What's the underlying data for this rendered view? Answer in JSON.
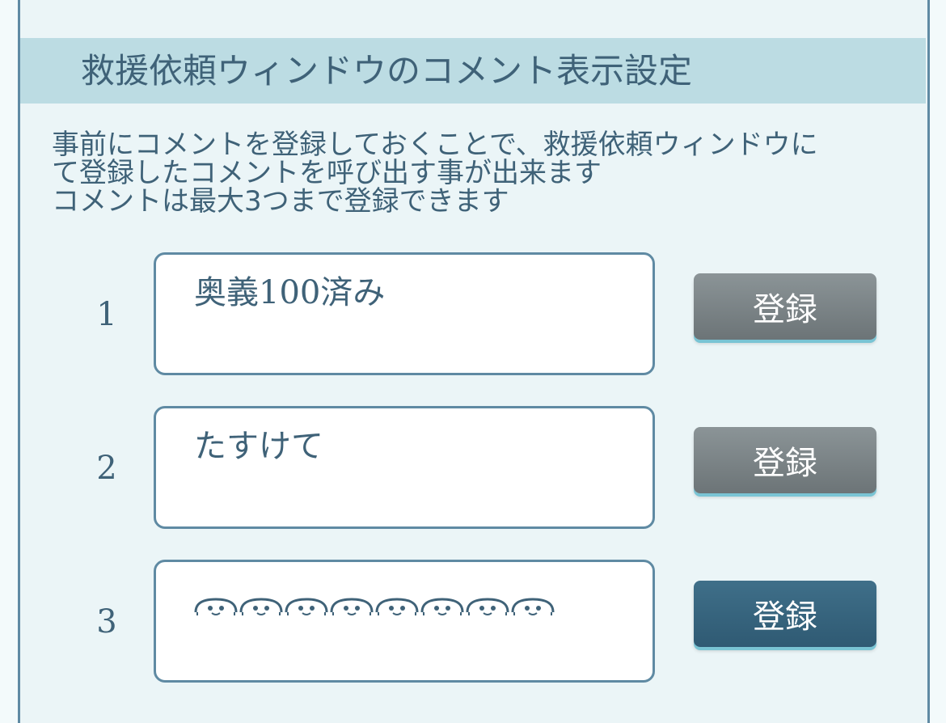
{
  "header": {
    "title": "救援依頼ウィンドウのコメント表示設定"
  },
  "description": {
    "line1": "事前にコメントを登録しておくことで、救援依頼ウィンドウに",
    "line2": "て登録したコメントを呼び出す事が出来ます",
    "line3": "コメントは最大3つまで登録できます"
  },
  "comments": [
    {
      "number": "1",
      "value": "奥義100済み",
      "button_label": "登録",
      "button_state": "inactive"
    },
    {
      "number": "2",
      "value": "たすけて",
      "button_label": "登録",
      "button_state": "inactive"
    },
    {
      "number": "3",
      "value": "",
      "button_label": "登録",
      "button_state": "active",
      "icons": "face-emoticon-icon x8"
    }
  ],
  "colors": {
    "panel_background": "#ebf5f7",
    "header_background": "#bcdce3",
    "text": "#3f6278",
    "border": "#5f8aa3",
    "button_inactive": "#7a8386",
    "button_active": "#3a6882",
    "button_underline": "#79c4d4"
  }
}
